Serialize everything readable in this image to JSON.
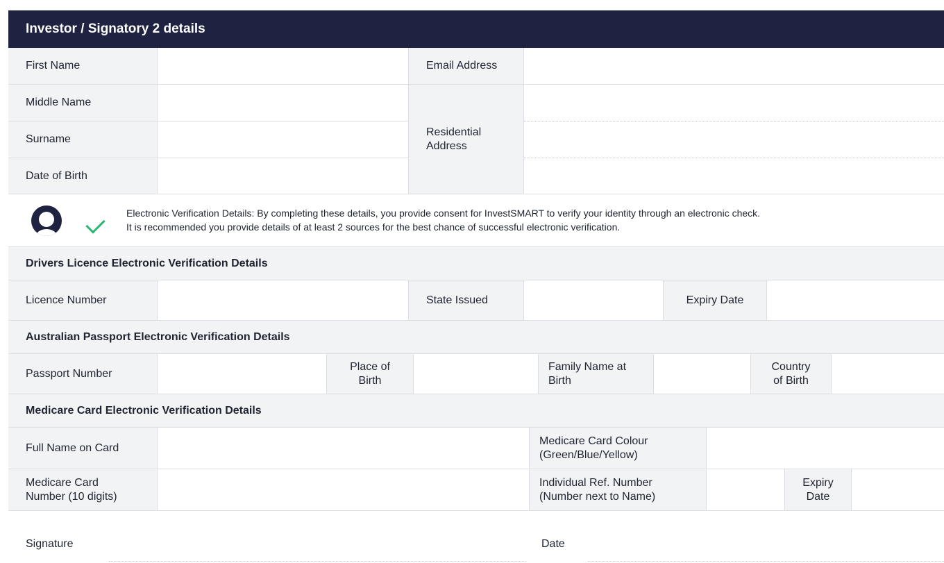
{
  "header": {
    "title": "Investor / Signatory 2 details"
  },
  "personal": {
    "first_name": "First Name",
    "middle_name": "Middle Name",
    "surname": "Surname",
    "date_of_birth": "Date of Birth",
    "email_address": "Email Address",
    "residential_address": "Residential Address"
  },
  "verification_notice": {
    "line1": "Electronic Verification Details: By completing these details, you provide consent for InvestSMART to verify your identity through an electronic check.",
    "line2": "It is recommended you provide details of at least 2 sources for the best chance of successful electronic verification.",
    "icons": [
      "person-icon",
      "checkmark-icon"
    ],
    "accent_color": "#2bb673"
  },
  "drivers_licence": {
    "title": "Drivers Licence Electronic Verification Details",
    "licence_number": "Licence Number",
    "state_issued": "State Issued",
    "expiry_date": "Expiry Date"
  },
  "passport": {
    "title": "Australian Passport Electronic Verification Details",
    "passport_number": "Passport Number",
    "place_of_birth": "Place of Birth",
    "family_name_at_birth": "Family Name at Birth",
    "country_of_birth": "Country of Birth"
  },
  "medicare": {
    "title": "Medicare Card Electronic Verification Details",
    "full_name": "Full Name on Card",
    "card_colour": "Medicare Card Colour (Green/Blue/Yellow)",
    "card_number": "Medicare Card Number (10 digits)",
    "ref_number": "Individual Ref. Number (Number next to Name)",
    "expiry_date": "Expiry Date"
  },
  "signature": {
    "signature_label": "Signature",
    "date_label": "Date"
  },
  "colors": {
    "header_bg": "#1f2240",
    "label_bg": "#f2f3f5",
    "border": "#dcdee3"
  }
}
